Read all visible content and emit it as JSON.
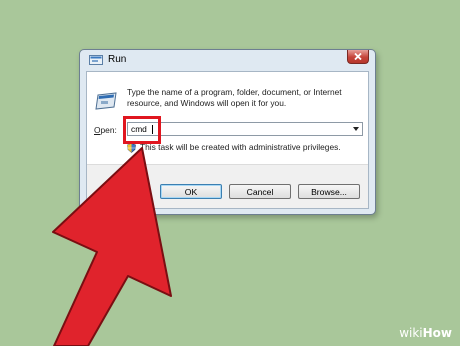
{
  "dialog": {
    "title": "Run",
    "description": "Type the name of a program, folder, document, or Internet resource, and Windows will open it for you.",
    "open_label_prefix": "O",
    "open_label_rest": "pen:",
    "open_value": "cmd",
    "admin_note": "This task will be created with administrative privileges.",
    "buttons": {
      "ok": "OK",
      "cancel": "Cancel",
      "browse": "Browse..."
    }
  },
  "watermark": {
    "wiki": "wiki",
    "how": "How"
  },
  "colors": {
    "background": "#a9c79a",
    "arrow": "#e0232c",
    "highlight": "#e0161f"
  },
  "icons": [
    "run-title-icon",
    "close-icon",
    "run-program-icon",
    "uac-shield-icon",
    "dropdown-arrow-icon",
    "pointer-arrow-icon"
  ]
}
